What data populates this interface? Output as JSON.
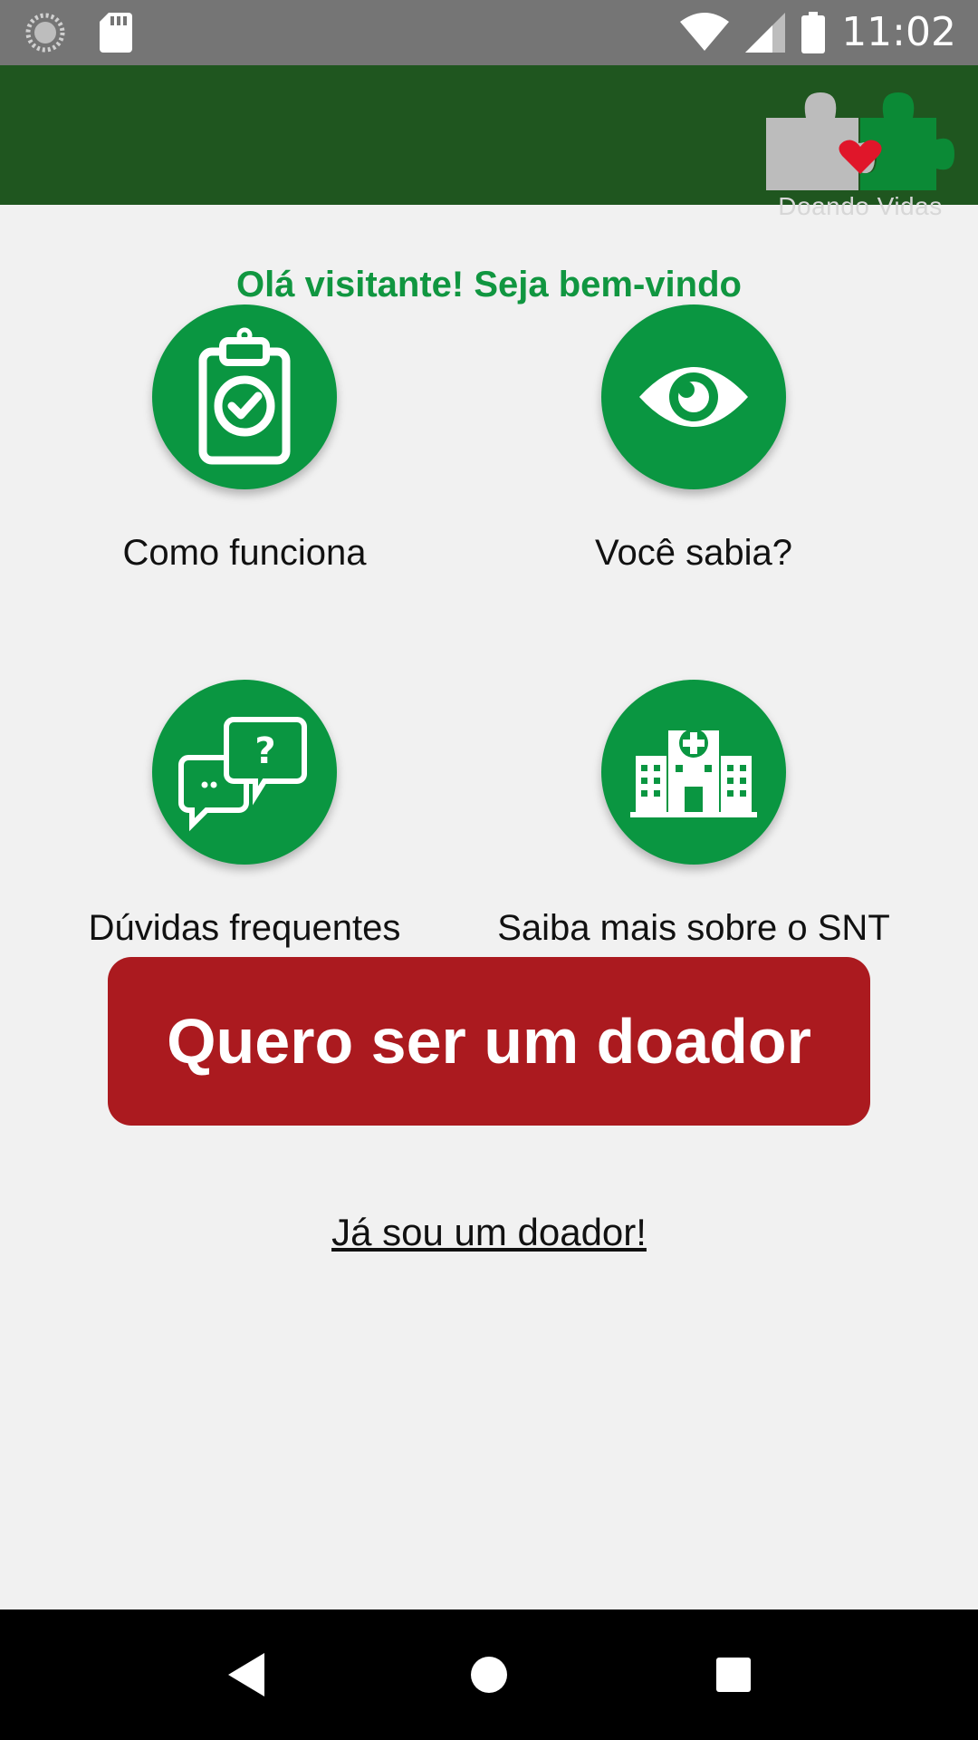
{
  "status_bar": {
    "time": "11:02",
    "icons": [
      "loading-icon",
      "sd-card-icon",
      "wifi-icon",
      "signal-icon",
      "battery-icon"
    ]
  },
  "app": {
    "logo_text": "Doando Vidas",
    "colors": {
      "appbar": "#1f561f",
      "accent": "#0a9641",
      "primary_button": "#ab1a1f",
      "greeting": "#109640"
    }
  },
  "greeting": "Olá visitante! Seja bem-vindo",
  "tiles": [
    {
      "label": "Como funciona",
      "icon": "clipboard-check-icon"
    },
    {
      "label": "Você sabia?",
      "icon": "eye-icon"
    },
    {
      "label": "Dúvidas frequentes",
      "icon": "chat-question-icon"
    },
    {
      "label": "Saiba mais sobre o SNT",
      "icon": "hospital-icon"
    }
  ],
  "primary_button": "Quero ser um doador",
  "secondary_link": "Já sou um doador!",
  "nav_bar": {
    "icons": [
      "back-icon",
      "home-icon",
      "recents-icon"
    ]
  }
}
